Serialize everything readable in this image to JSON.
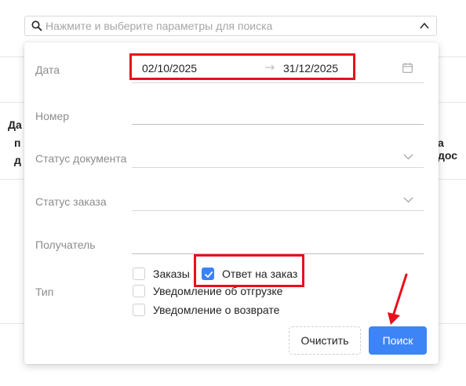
{
  "search": {
    "placeholder": "Нажмите и выберите параметры для поиска",
    "icon": "search-icon",
    "toggle_icon": "chevron-up-icon"
  },
  "background": {
    "fragments": [
      "Да",
      "п",
      "д",
      "а дос"
    ]
  },
  "filters": {
    "date": {
      "label": "Дата",
      "from": "02/10/2025",
      "to": "31/12/2025",
      "separator_icon": "arrow-right-icon",
      "calendar_icon": "calendar-icon"
    },
    "number": {
      "label": "Номер",
      "value": ""
    },
    "document_status": {
      "label": "Статус документа",
      "value": ""
    },
    "order_status": {
      "label": "Статус заказа",
      "value": ""
    },
    "recipient": {
      "label": "Получатель",
      "value": ""
    },
    "type": {
      "label": "Тип",
      "options": [
        {
          "label": "Заказы",
          "checked": false
        },
        {
          "label": "Ответ на заказ",
          "checked": true
        },
        {
          "label": "Уведомление об отгрузке",
          "checked": false
        },
        {
          "label": "Уведомление о возврате",
          "checked": false
        }
      ]
    }
  },
  "buttons": {
    "clear": "Очистить",
    "search": "Поиск"
  },
  "colors": {
    "accent": "#3d85f6",
    "annotation": "#e8101a"
  }
}
